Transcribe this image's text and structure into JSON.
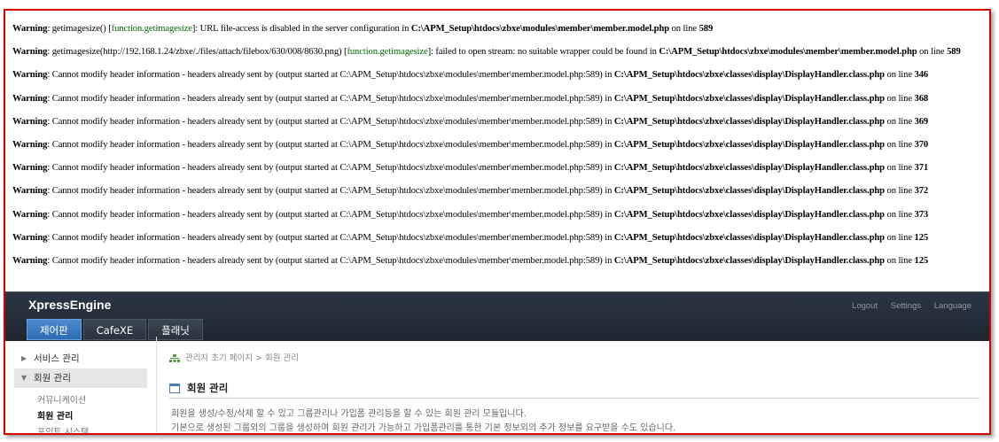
{
  "warnings": [
    {
      "label": "Warning",
      "pre": ": getimagesize() [",
      "fn": "function.getimagesize",
      "mid": "]: URL file-access is disabled in the server configuration in ",
      "file": "C:\\APM_Setup\\htdocs\\zbxe\\modules\\member\\member.model.php",
      "on": " on line ",
      "line": "589"
    },
    {
      "label": "Warning",
      "pre": ": getimagesize(http://192.168.1.24/zbxe/./files/attach/filebox/630/008/8630.png) [",
      "fn": "function.getimagesize",
      "mid": "]: failed to open stream: no suitable wrapper could be found in ",
      "file": "C:\\APM_Setup\\htdocs\\zbxe\\modules\\member\\member.model.php",
      "on": " on line ",
      "line": "589"
    },
    {
      "label": "Warning",
      "pre": ": Cannot modify header information - headers already sent by (output started at C:\\APM_Setup\\htdocs\\zbxe\\modules\\member\\member.model.php:589) in ",
      "fn": "",
      "mid": "",
      "file": "C:\\APM_Setup\\htdocs\\zbxe\\classes\\display\\DisplayHandler.class.php",
      "on": " on line ",
      "line": "346"
    },
    {
      "label": "Warning",
      "pre": ": Cannot modify header information - headers already sent by (output started at C:\\APM_Setup\\htdocs\\zbxe\\modules\\member\\member.model.php:589) in ",
      "fn": "",
      "mid": "",
      "file": "C:\\APM_Setup\\htdocs\\zbxe\\classes\\display\\DisplayHandler.class.php",
      "on": " on line ",
      "line": "368"
    },
    {
      "label": "Warning",
      "pre": ": Cannot modify header information - headers already sent by (output started at C:\\APM_Setup\\htdocs\\zbxe\\modules\\member\\member.model.php:589) in ",
      "fn": "",
      "mid": "",
      "file": "C:\\APM_Setup\\htdocs\\zbxe\\classes\\display\\DisplayHandler.class.php",
      "on": " on line ",
      "line": "369"
    },
    {
      "label": "Warning",
      "pre": ": Cannot modify header information - headers already sent by (output started at C:\\APM_Setup\\htdocs\\zbxe\\modules\\member\\member.model.php:589) in ",
      "fn": "",
      "mid": "",
      "file": "C:\\APM_Setup\\htdocs\\zbxe\\classes\\display\\DisplayHandler.class.php",
      "on": " on line ",
      "line": "370"
    },
    {
      "label": "Warning",
      "pre": ": Cannot modify header information - headers already sent by (output started at C:\\APM_Setup\\htdocs\\zbxe\\modules\\member\\member.model.php:589) in ",
      "fn": "",
      "mid": "",
      "file": "C:\\APM_Setup\\htdocs\\zbxe\\classes\\display\\DisplayHandler.class.php",
      "on": " on line ",
      "line": "371"
    },
    {
      "label": "Warning",
      "pre": ": Cannot modify header information - headers already sent by (output started at C:\\APM_Setup\\htdocs\\zbxe\\modules\\member\\member.model.php:589) in ",
      "fn": "",
      "mid": "",
      "file": "C:\\APM_Setup\\htdocs\\zbxe\\classes\\display\\DisplayHandler.class.php",
      "on": " on line ",
      "line": "372"
    },
    {
      "label": "Warning",
      "pre": ": Cannot modify header information - headers already sent by (output started at C:\\APM_Setup\\htdocs\\zbxe\\modules\\member\\member.model.php:589) in ",
      "fn": "",
      "mid": "",
      "file": "C:\\APM_Setup\\htdocs\\zbxe\\classes\\display\\DisplayHandler.class.php",
      "on": " on line ",
      "line": "373"
    },
    {
      "label": "Warning",
      "pre": ": Cannot modify header information - headers already sent by (output started at C:\\APM_Setup\\htdocs\\zbxe\\modules\\member\\member.model.php:589) in ",
      "fn": "",
      "mid": "",
      "file": "C:\\APM_Setup\\htdocs\\zbxe\\classes\\display\\DisplayHandler.class.php",
      "on": " on line ",
      "line": "125"
    },
    {
      "label": "Warning",
      "pre": ": Cannot modify header information - headers already sent by (output started at C:\\APM_Setup\\htdocs\\zbxe\\modules\\member\\member.model.php:589) in ",
      "fn": "",
      "mid": "",
      "file": "C:\\APM_Setup\\htdocs\\zbxe\\classes\\display\\DisplayHandler.class.php",
      "on": " on line ",
      "line": "125"
    }
  ],
  "header": {
    "brand": "XpressEngine",
    "links": [
      "Logout",
      "Settings",
      "Language"
    ],
    "tabs": [
      "제어판",
      "CafeXE",
      "플래닛"
    ]
  },
  "sidebar": {
    "items": [
      "서비스 관리",
      "회원 관리"
    ],
    "subitems": [
      "커뮤니케이션",
      "회원 관리",
      "포인트 시스템"
    ]
  },
  "main": {
    "breadcrumb": [
      "관리자 초기 페이지",
      ">",
      "회원 관리"
    ],
    "title": "회원 관리",
    "desc1": "회원을 생성/수정/삭제 할 수 있고 그룹관리나 가입폼 관리등을 할 수 있는 회원 관리 모듈입니다.",
    "desc2": "기본으로 생성된 그룹외의 그룹을 생성하여 회원 관리가 가능하고 가입폼관리를 통한 기본 정보외의 추가 정보를 요구받을 수도 있습니다."
  },
  "colors": {
    "frame": "#d40000",
    "header_bg": "#1d2631",
    "active_tab": "#2e6bb0",
    "fn_link": "#006600"
  }
}
